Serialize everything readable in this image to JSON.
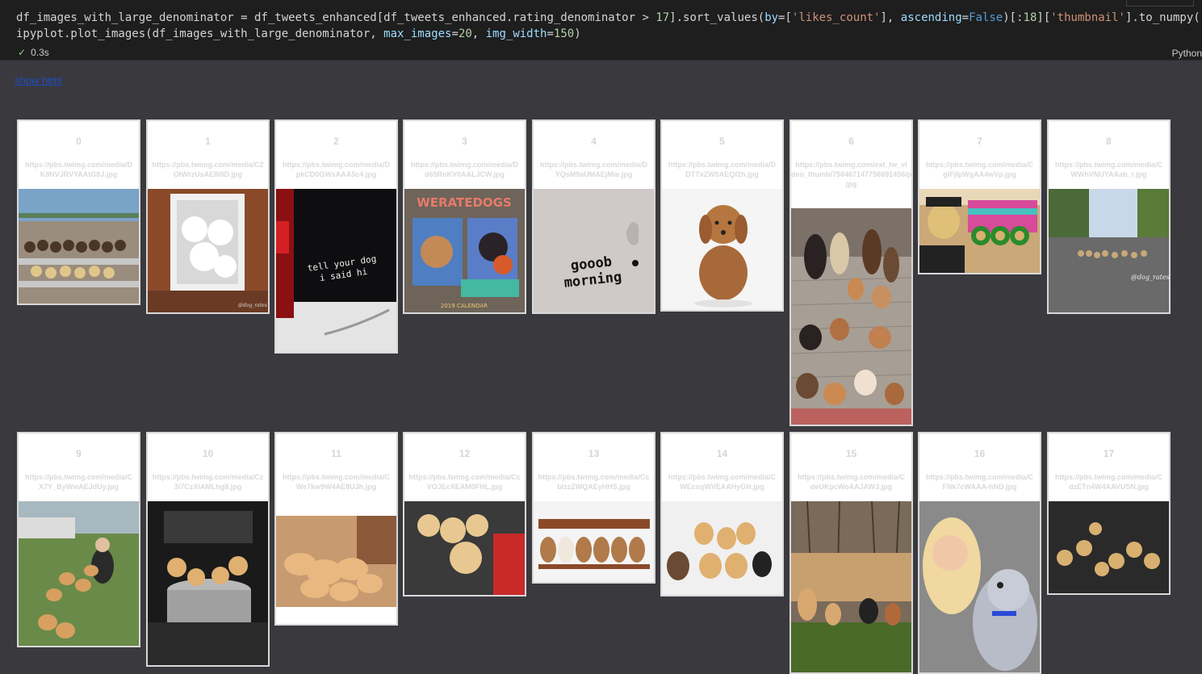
{
  "code": {
    "line1": "df_images_with_large_denominator = df_tweets_enhanced[df_tweets_enhanced.rating_denominator > 17].sort_values(by=['likes_count'], ascending=False)[:18]['thumbnail'].to_numpy()",
    "line2": "ipyplot.plot_images(df_images_with_large_denominator, max_images=20, img_width=150)"
  },
  "status": {
    "time": "0.3s",
    "language": "Python"
  },
  "output": {
    "show_html_label": "show html"
  },
  "tiles": [
    {
      "index": "0",
      "url1": "https://pbs.twimg.com/media/D",
      "url2": "K8NVJRVYAAtG8J.jpg",
      "url3": "",
      "image_icon": "dogs-on-bleachers-photo"
    },
    {
      "index": "1",
      "url1": "https://pbs.twimg.com/media/C2",
      "url2": "OtWrzUsAE8i0D.jpg",
      "url3": "",
      "image_icon": "puppies-in-doorway-photo"
    },
    {
      "index": "2",
      "url1": "https://pbs.twimg.com/media/D",
      "url2": "pkCD0GWsAAA5c4.jpg",
      "url3": "",
      "image_icon": "car-window-sticker-photo"
    },
    {
      "index": "3",
      "url1": "https://pbs.twimg.com/media/D",
      "url2": "d65RnKV0AALJCW.jpg",
      "url3": "",
      "image_icon": "calendar-cover-photo"
    },
    {
      "index": "4",
      "url1": "https://pbs.twimg.com/media/D",
      "url2": "YQsM9aUMAEjMie.jpg",
      "url3": "",
      "image_icon": "laptop-sticker-photo"
    },
    {
      "index": "5",
      "url1": "https://pbs.twimg.com/media/D",
      "url2": "DTTxZW0AEQf2h.jpg",
      "url3": "",
      "image_icon": "fluffy-puppy-photo"
    },
    {
      "index": "6",
      "url1": "https://pbs.twimg.com/ext_tw_vi",
      "url2": "deo_thumb/758467147756691456/pu/img/YTNzjRFDSPNXukmM.",
      "url3": "jpg",
      "image_icon": "many-dogs-on-porch-photo"
    },
    {
      "index": "7",
      "url1": "https://pbs.twimg.com/media/C",
      "url2": "giFjlpWgAA4wVp.jpg",
      "url3": "",
      "image_icon": "dogs-in-costumes-photo"
    },
    {
      "index": "8",
      "url1": "https://pbs.twimg.com/media/C",
      "url2": "WWhVNUYAAab_r.jpg",
      "url3": "",
      "image_icon": "dogs-on-street-photo"
    },
    {
      "index": "9",
      "url1": "https://pbs.twimg.com/media/C",
      "url2": "X7Y_ByWwAEJdUy.jpg",
      "url3": "",
      "image_icon": "woman-with-puppies-photo"
    },
    {
      "index": "10",
      "url1": "https://pbs.twimg.com/media/Cz",
      "url2": "3i7CzXIAMLhg8.jpg",
      "url3": "",
      "image_icon": "puppies-in-tub-photo"
    },
    {
      "index": "11",
      "url1": "https://pbs.twimg.com/media/C",
      "url2": "We7kw9W4AE8UJh.jpg",
      "url3": "",
      "image_icon": "puppy-pile-photo"
    },
    {
      "index": "12",
      "url1": "https://pbs.twimg.com/media/Cc",
      "url2": "VOJEcXEAM0FHL.jpg",
      "url3": "",
      "image_icon": "puppies-held-photo"
    },
    {
      "index": "13",
      "url1": "https://pbs.twimg.com/media/Cc",
      "url2": "blzzZWQAEyHHS.jpg",
      "url3": "",
      "image_icon": "puppies-on-bench-photo"
    },
    {
      "index": "14",
      "url1": "https://pbs.twimg.com/media/C",
      "url2": "WEcxqWVEAAHyGH.jpg",
      "url3": "",
      "image_icon": "puppies-in-bath-photo"
    },
    {
      "index": "15",
      "url1": "https://pbs.twimg.com/media/C",
      "url2": "deUKpcWoAAJAWJ.jpg",
      "url3": "",
      "image_icon": "dogs-by-fence-photo"
    },
    {
      "index": "16",
      "url1": "https://pbs.twimg.com/media/C",
      "url2": "FNk7cWAAA-hND.jpg",
      "url3": "",
      "image_icon": "woman-with-dog-selfie-photo"
    },
    {
      "index": "17",
      "url1": "https://pbs.twimg.com/media/C",
      "url2": "dzETn4W4AAVUSN.jpg",
      "url3": "",
      "image_icon": "puppies-in-dark-photo"
    }
  ],
  "sticker_text": {
    "car": "tell your dog i said hi",
    "laptop": "gooob morning",
    "calendar_title": "WERATEDOGS",
    "calendar_footer": "2019 CALENDAR"
  },
  "colors": {
    "code_bg": "#1e1e1e",
    "output_bg": "#3a393e",
    "keyword_blue": "#9cdcfe",
    "string_orange": "#ce9178",
    "number_green": "#b5cea8",
    "link": "#1d4cc7",
    "check": "#89d185"
  }
}
